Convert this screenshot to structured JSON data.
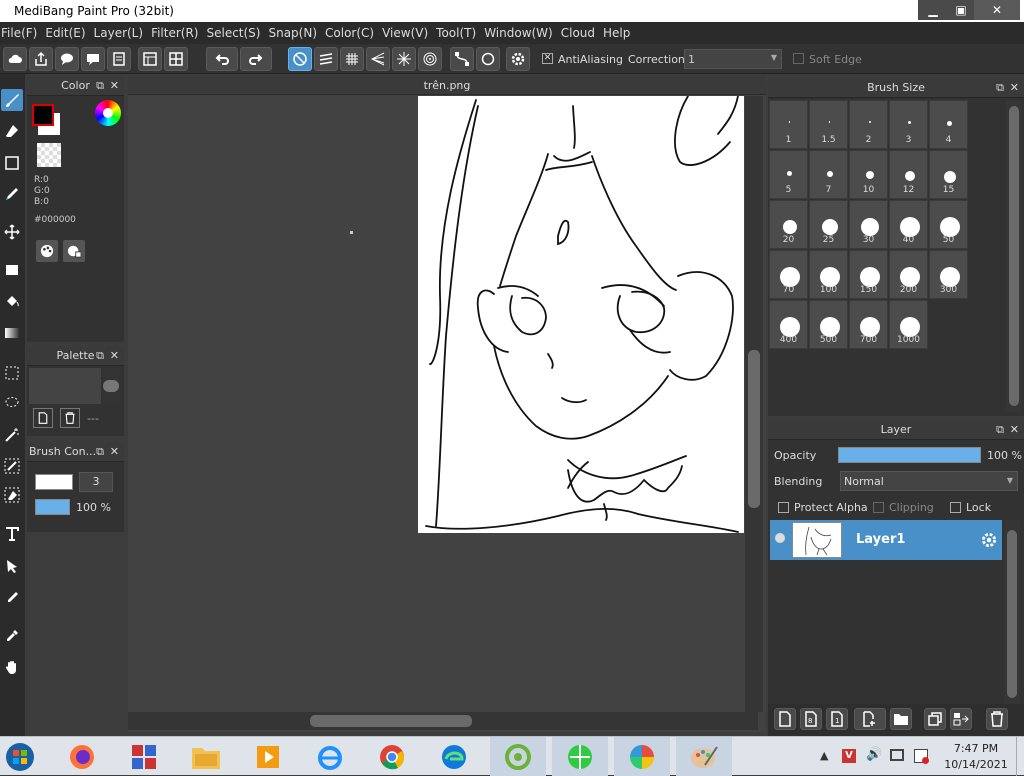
{
  "window": {
    "title": "MediBang Paint Pro (32bit)",
    "minimize": "▁",
    "maximize": "▣",
    "close": "✕"
  },
  "menu": [
    "File(F)",
    "Edit(E)",
    "Layer(L)",
    "Filter(R)",
    "Select(S)",
    "Snap(N)",
    "Color(C)",
    "View(V)",
    "Tool(T)",
    "Window(W)",
    "Cloud",
    "Help"
  ],
  "toolbar": {
    "antialiasing_label": "AntiAliasing",
    "antialiasing_checked": "✕",
    "correction_label": "Correction",
    "correction_value": "1",
    "soft_edge_label": "Soft Edge"
  },
  "color_panel": {
    "title": "Color",
    "r": "R:0",
    "g": "G:0",
    "b": "B:0",
    "hex": "#000000",
    "primary_color": "#000000",
    "secondary_color": "#ffffff"
  },
  "palette_panel": {
    "title": "Palette",
    "value": "---"
  },
  "brush_control": {
    "title": "Brush Con...",
    "size": "3",
    "opacity": "100 %"
  },
  "canvas": {
    "tab_title": "trên.png"
  },
  "brush_size": {
    "title": "Brush Size",
    "sizes": [
      "1",
      "1.5",
      "2",
      "3",
      "4",
      "5",
      "7",
      "10",
      "12",
      "15",
      "20",
      "25",
      "30",
      "40",
      "50",
      "70",
      "100",
      "150",
      "200",
      "300",
      "400",
      "500",
      "700",
      "1000"
    ]
  },
  "layer_panel": {
    "title": "Layer",
    "opacity_label": "Opacity",
    "opacity_value": "100 %",
    "blending_label": "Blending",
    "blending_value": "Normal",
    "protect_alpha": "Protect Alpha",
    "clipping": "Clipping",
    "lock": "Lock",
    "layer_name": "Layer1"
  },
  "taskbar": {
    "time": "7:47 PM",
    "date": "10/14/2021",
    "apps": [
      "windows-start",
      "firefox",
      "unikey",
      "file-explorer",
      "media-player",
      "internet-explorer",
      "chrome",
      "edge",
      "coccoc",
      "green-browser",
      "color-picker-app",
      "paint-app"
    ]
  },
  "colors": {
    "accent": "#4a90c8",
    "panel_bg": "#323232",
    "canvas_bg": "#424242"
  }
}
